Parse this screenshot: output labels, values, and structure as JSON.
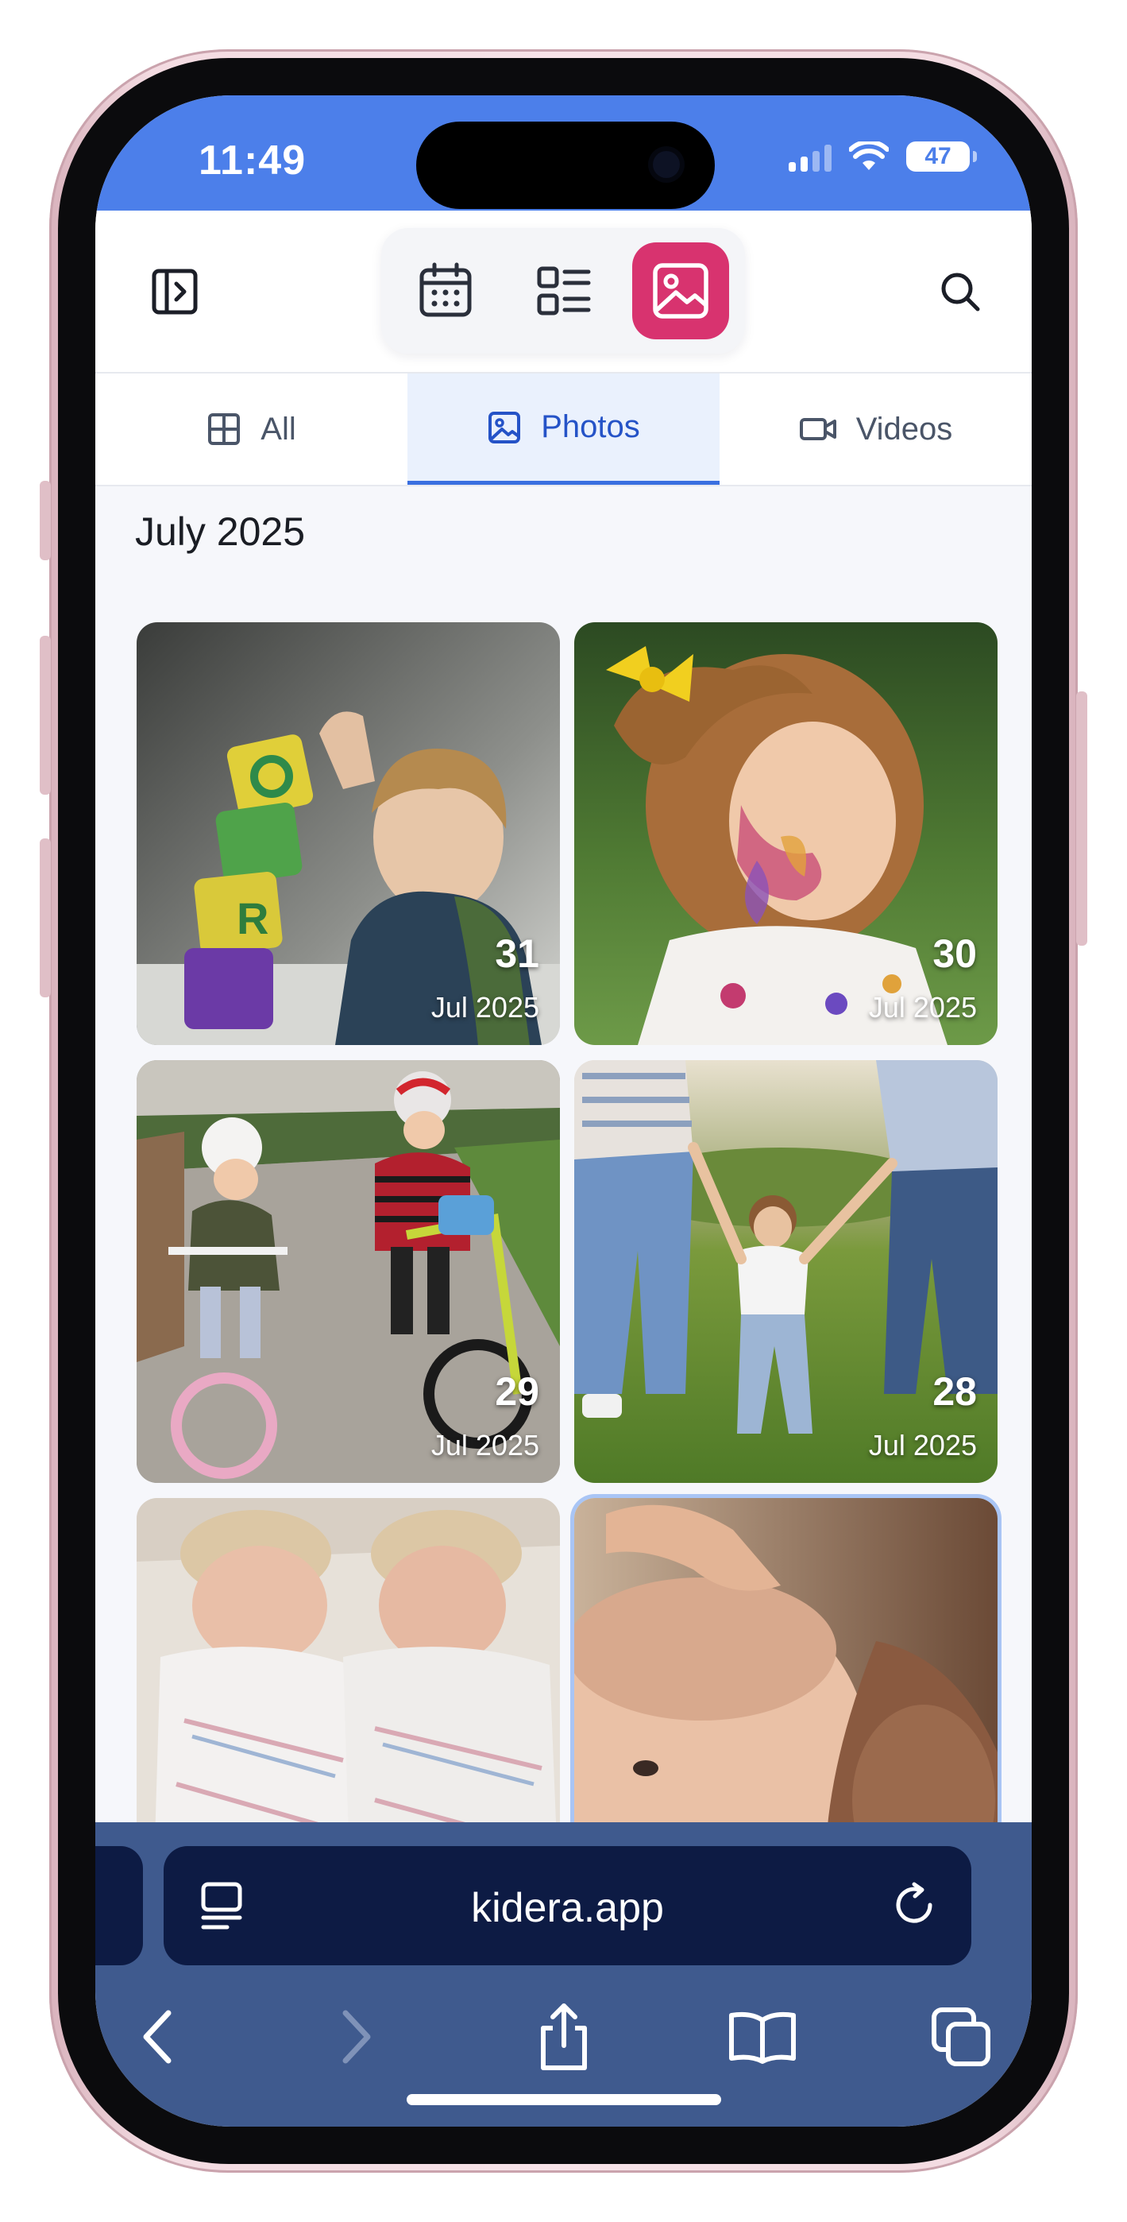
{
  "status_bar": {
    "time": "11:49",
    "battery": "47"
  },
  "header": {
    "sidebar_toggle_icon": "sidebar-toggle-icon",
    "view_switch": [
      "calendar-icon",
      "list-view-icon",
      "gallery-icon"
    ],
    "active_view": "gallery",
    "search_icon": "search-icon",
    "accent_color": "#d8336f"
  },
  "tabs": [
    {
      "label": "All",
      "icon": "grid-icon"
    },
    {
      "label": "Photos",
      "icon": "image-icon",
      "active": true
    },
    {
      "label": "Videos",
      "icon": "video-icon"
    }
  ],
  "month": "July 2025",
  "photos": [
    {
      "day": "31",
      "month": "Jul 2025",
      "subject": "toddler stacking letter blocks"
    },
    {
      "day": "30",
      "month": "Jul 2025",
      "subject": "girl with yellow bow and face paint"
    },
    {
      "day": "29",
      "month": "Jul 2025",
      "subject": "two kids on bikes on sidewalk"
    },
    {
      "day": "28",
      "month": "Jul 2025",
      "subject": "toddler walking holding parents' hands"
    },
    {
      "day": "",
      "month": "",
      "subject": "newborn twins in blankets"
    },
    {
      "day": "",
      "month": "",
      "subject": "newborn head with parent's hand"
    }
  ],
  "browser": {
    "url": "kidera.app"
  },
  "colors": {
    "status_bar": "#4c7fea",
    "toolbar": "#3f5a8e",
    "url_field": "#0d1b44",
    "active_tab": "#2553c7"
  }
}
